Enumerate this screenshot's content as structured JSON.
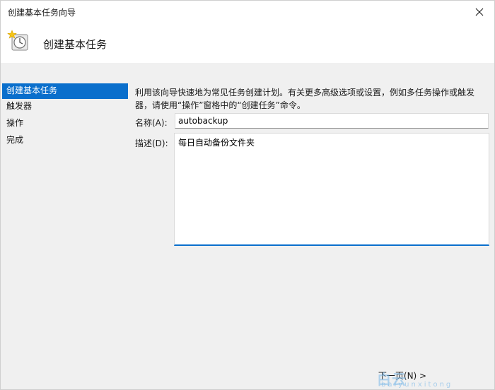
{
  "window": {
    "title": "创建基本任务向导"
  },
  "header": {
    "title": "创建基本任务",
    "icon": "task-clock-icon"
  },
  "sidebar": {
    "items": [
      {
        "label": "创建基本任务",
        "active": true
      },
      {
        "label": "触发器",
        "active": false
      },
      {
        "label": "操作",
        "active": false
      },
      {
        "label": "完成",
        "active": false
      }
    ]
  },
  "main": {
    "description": "利用该向导快速地为常见任务创建计划。有关更多高级选项或设置，例如多任务操作或触发器，请使用“操作”窗格中的“创建任务”命令。",
    "name_label": "名称(A):",
    "name_value": "autobackup",
    "desc_label": "描述(D):",
    "desc_value": "每日自动备份文件夹"
  },
  "footer": {
    "next_label": "下一页(N) >"
  },
  "colors": {
    "accent": "#0a6fcc",
    "panel_bg": "#f0f0f0"
  }
}
